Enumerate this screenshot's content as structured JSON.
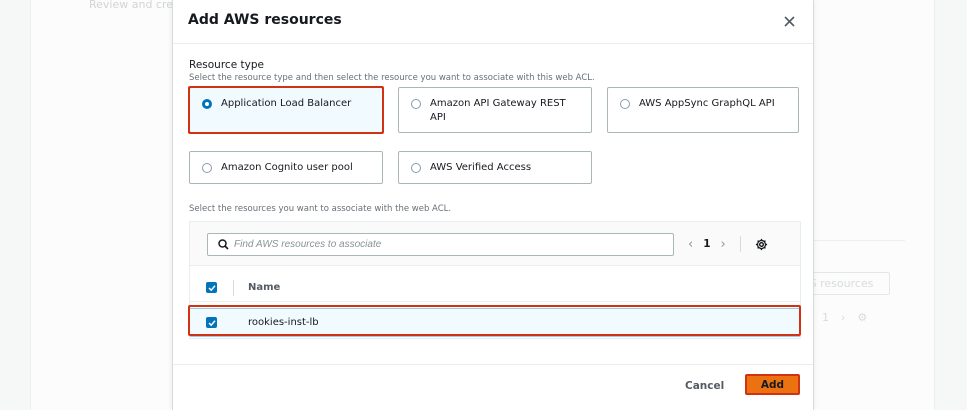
{
  "background": {
    "header_text": "Review and create web",
    "button_label": "S resources",
    "pager_number": "1"
  },
  "modal": {
    "title": "Add AWS resources",
    "close_icon": "close-icon",
    "resource_type": {
      "label": "Resource type",
      "description": "Select the resource type and then select the resource you want to associate with this web ACL.",
      "options": [
        {
          "label": "Application Load Balancer",
          "selected": true
        },
        {
          "label_line1": "Amazon API Gateway REST",
          "label_line2": "API",
          "selected": false
        },
        {
          "label": "AWS AppSync GraphQL API",
          "selected": false
        },
        {
          "label": "Amazon Cognito user pool",
          "selected": false
        },
        {
          "label": "AWS Verified Access",
          "selected": false
        }
      ]
    },
    "resources": {
      "description": "Select the resources you want to associate with the web ACL.",
      "search_placeholder": "Find AWS resources to associate",
      "page_number": "1",
      "column_header": "Name",
      "rows": [
        {
          "name": "rookies-inst-lb",
          "checked": true
        }
      ]
    },
    "footer": {
      "cancel_label": "Cancel",
      "add_label": "Add"
    }
  },
  "colors": {
    "accent_blue": "#0073bb",
    "primary_orange": "#ec7211",
    "highlight_red": "#d13212"
  }
}
